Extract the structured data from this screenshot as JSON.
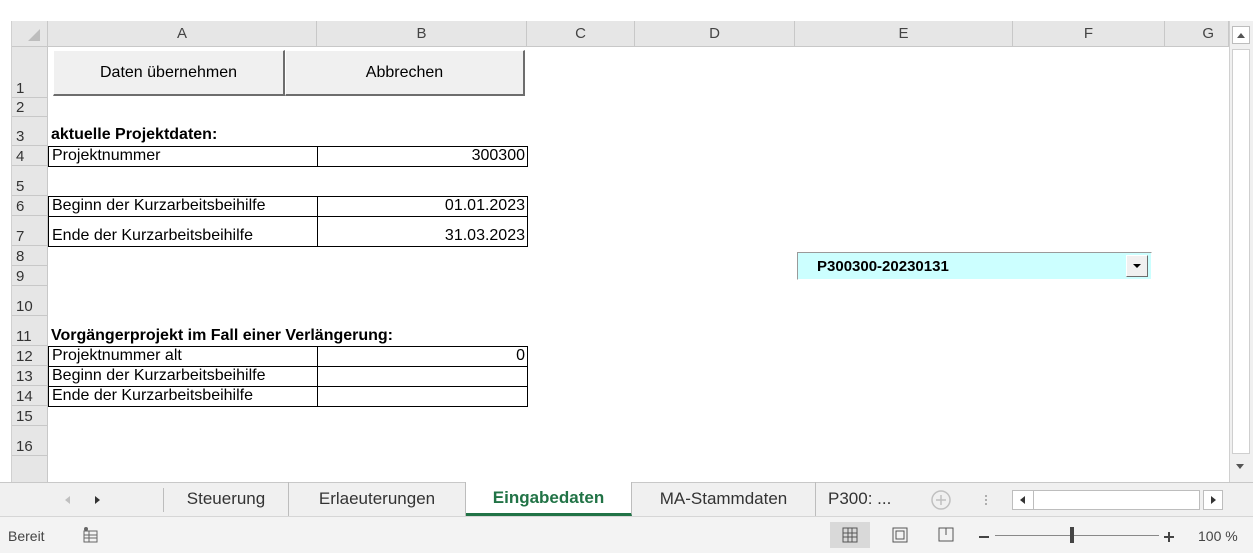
{
  "columns": [
    "A",
    "B",
    "C",
    "D",
    "E",
    "F",
    "G"
  ],
  "rows": [
    "1",
    "2",
    "3",
    "4",
    "5",
    "6",
    "7",
    "8",
    "9",
    "10",
    "11",
    "12",
    "13",
    "14",
    "15",
    "16"
  ],
  "buttons": {
    "apply": "Daten übernehmen",
    "cancel": "Abbrechen"
  },
  "cells": {
    "a3": "aktuelle Projektdaten:",
    "a4": "Projektnummer",
    "b4": "300300",
    "a6": "Beginn der Kurzarbeitsbeihilfe",
    "b6": "01.01.2023",
    "a7": "Ende der Kurzarbeitsbeihilfe",
    "b7": "31.03.2023",
    "a11": "Vorgängerprojekt im Fall einer Verlängerung:",
    "a12": "Projektnummer alt",
    "b12": "0",
    "a13": "Beginn der Kurzarbeitsbeihilfe",
    "a14": "Ende der Kurzarbeitsbeihilfe"
  },
  "combo": {
    "value": "P300300-20230131",
    "bg": "#ccffff"
  },
  "tabs": [
    {
      "label": "Steuerung"
    },
    {
      "label": "Erlaeuterungen"
    },
    {
      "label": "Eingabedaten",
      "active": true
    },
    {
      "label": "MA-Stammdaten"
    },
    {
      "label": "P300: ..."
    }
  ],
  "status": {
    "ready": "Bereit",
    "zoom": "100 %"
  },
  "colors": {
    "active_tab": "#217346"
  },
  "icons": [
    "select-all-triangle-icon",
    "scroll-up-icon",
    "scroll-down-icon",
    "tab-prev-icon",
    "tab-next-icon",
    "add-sheet-icon",
    "hscroll-left-icon",
    "hscroll-right-icon",
    "macro-record-icon",
    "normal-view-icon",
    "page-layout-icon",
    "page-break-icon",
    "zoom-out-icon",
    "zoom-in-icon",
    "dropdown-arrow-icon"
  ]
}
